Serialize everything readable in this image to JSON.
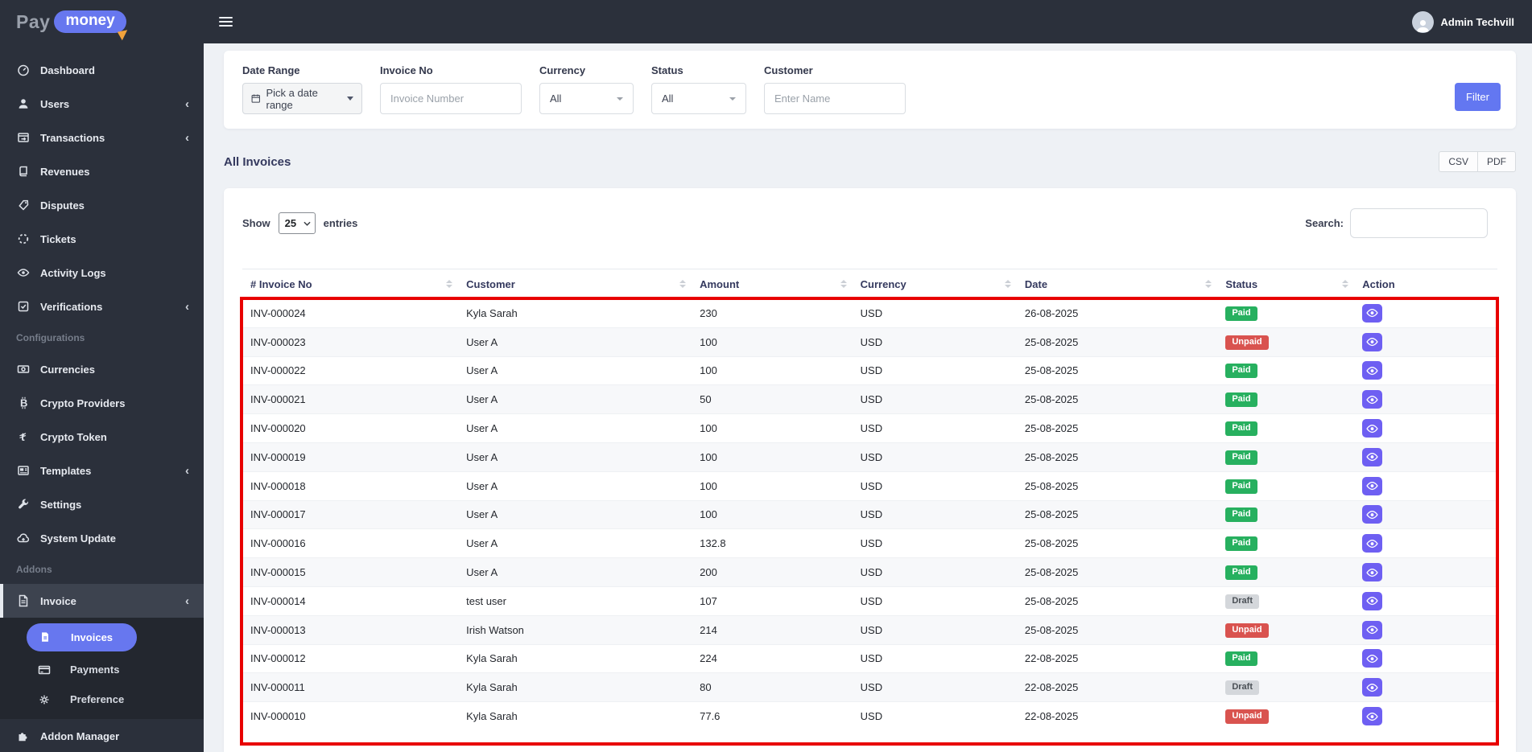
{
  "brand": {
    "pay": "Pay",
    "money": "money"
  },
  "topbar": {
    "user_name": "Admin Techvill"
  },
  "sidebar": {
    "items": [
      {
        "label": "Dashboard"
      },
      {
        "label": "Users"
      },
      {
        "label": "Transactions"
      },
      {
        "label": "Revenues"
      },
      {
        "label": "Disputes"
      },
      {
        "label": "Tickets"
      },
      {
        "label": "Activity Logs"
      },
      {
        "label": "Verifications"
      },
      {
        "label": "Configurations"
      },
      {
        "label": "Currencies"
      },
      {
        "label": "Crypto Providers"
      },
      {
        "label": "Crypto Token"
      },
      {
        "label": "Templates"
      },
      {
        "label": "Settings"
      },
      {
        "label": "System Update"
      },
      {
        "label": "Addons"
      },
      {
        "label": "Invoice"
      },
      {
        "label": "Invoices"
      },
      {
        "label": "Payments"
      },
      {
        "label": "Preference"
      },
      {
        "label": "Addon Manager"
      }
    ]
  },
  "filters": {
    "date_range": {
      "label": "Date Range",
      "value": "Pick a date range"
    },
    "invoice_no": {
      "label": "Invoice No",
      "placeholder": "Invoice Number"
    },
    "currency": {
      "label": "Currency",
      "value": "All"
    },
    "status": {
      "label": "Status",
      "value": "All"
    },
    "customer": {
      "label": "Customer",
      "placeholder": "Enter Name"
    },
    "submit_label": "Filter"
  },
  "section": {
    "title": "All Invoices",
    "export_csv": "CSV",
    "export_pdf": "PDF"
  },
  "table_controls": {
    "show_label": "Show",
    "page_length": "25",
    "entries_label": "entries",
    "search_label": "Search:",
    "search_value": ""
  },
  "invoices": {
    "columns": [
      "# Invoice No",
      "Customer",
      "Amount",
      "Currency",
      "Date",
      "Status",
      "Action"
    ],
    "rows": [
      {
        "invoice_no": "INV-000024",
        "customer": "Kyla Sarah",
        "amount": "230",
        "currency": "USD",
        "date": "26-08-2025",
        "status": "Paid",
        "status_class": "paid"
      },
      {
        "invoice_no": "INV-000023",
        "customer": "User A",
        "amount": "100",
        "currency": "USD",
        "date": "25-08-2025",
        "status": "Unpaid",
        "status_class": "unpaid"
      },
      {
        "invoice_no": "INV-000022",
        "customer": "User A",
        "amount": "100",
        "currency": "USD",
        "date": "25-08-2025",
        "status": "Paid",
        "status_class": "paid"
      },
      {
        "invoice_no": "INV-000021",
        "customer": "User A",
        "amount": "50",
        "currency": "USD",
        "date": "25-08-2025",
        "status": "Paid",
        "status_class": "paid"
      },
      {
        "invoice_no": "INV-000020",
        "customer": "User A",
        "amount": "100",
        "currency": "USD",
        "date": "25-08-2025",
        "status": "Paid",
        "status_class": "paid"
      },
      {
        "invoice_no": "INV-000019",
        "customer": "User A",
        "amount": "100",
        "currency": "USD",
        "date": "25-08-2025",
        "status": "Paid",
        "status_class": "paid"
      },
      {
        "invoice_no": "INV-000018",
        "customer": "User A",
        "amount": "100",
        "currency": "USD",
        "date": "25-08-2025",
        "status": "Paid",
        "status_class": "paid"
      },
      {
        "invoice_no": "INV-000017",
        "customer": "User A",
        "amount": "100",
        "currency": "USD",
        "date": "25-08-2025",
        "status": "Paid",
        "status_class": "paid"
      },
      {
        "invoice_no": "INV-000016",
        "customer": "User A",
        "amount": "132.8",
        "currency": "USD",
        "date": "25-08-2025",
        "status": "Paid",
        "status_class": "paid"
      },
      {
        "invoice_no": "INV-000015",
        "customer": "User A",
        "amount": "200",
        "currency": "USD",
        "date": "25-08-2025",
        "status": "Paid",
        "status_class": "paid"
      },
      {
        "invoice_no": "INV-000014",
        "customer": "test user",
        "amount": "107",
        "currency": "USD",
        "date": "25-08-2025",
        "status": "Draft",
        "status_class": "draft"
      },
      {
        "invoice_no": "INV-000013",
        "customer": "Irish Watson",
        "amount": "214",
        "currency": "USD",
        "date": "25-08-2025",
        "status": "Unpaid",
        "status_class": "unpaid"
      },
      {
        "invoice_no": "INV-000012",
        "customer": "Kyla Sarah",
        "amount": "224",
        "currency": "USD",
        "date": "22-08-2025",
        "status": "Paid",
        "status_class": "paid"
      },
      {
        "invoice_no": "INV-000011",
        "customer": "Kyla Sarah",
        "amount": "80",
        "currency": "USD",
        "date": "22-08-2025",
        "status": "Draft",
        "status_class": "draft"
      },
      {
        "invoice_no": "INV-000010",
        "customer": "Kyla Sarah",
        "amount": "77.6",
        "currency": "USD",
        "date": "22-08-2025",
        "status": "Unpaid",
        "status_class": "unpaid"
      }
    ]
  },
  "colors": {
    "accent_purple": "#6777ef",
    "paid_green": "#27b05f",
    "unpaid_red": "#d9534f",
    "draft_gray": "#d4d7db",
    "annotation_red": "#e80000",
    "sidebar_bg": "#2b303b"
  }
}
